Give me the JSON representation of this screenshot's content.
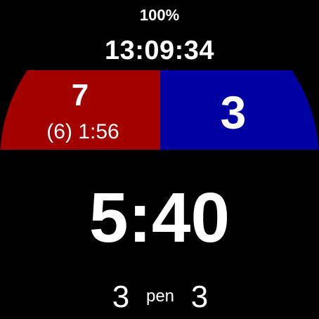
{
  "status": {
    "battery": "100%",
    "time": "13:09:34"
  },
  "colors": {
    "home": "#a30000",
    "away": "#0000a3",
    "background": "#000000",
    "text": "#ffffff"
  },
  "home": {
    "score": "7",
    "penalty": "(6) 1:56"
  },
  "away": {
    "score": "3"
  },
  "game_clock": "5:40",
  "penalties": {
    "home": "3",
    "label": "pen",
    "away": "3"
  }
}
